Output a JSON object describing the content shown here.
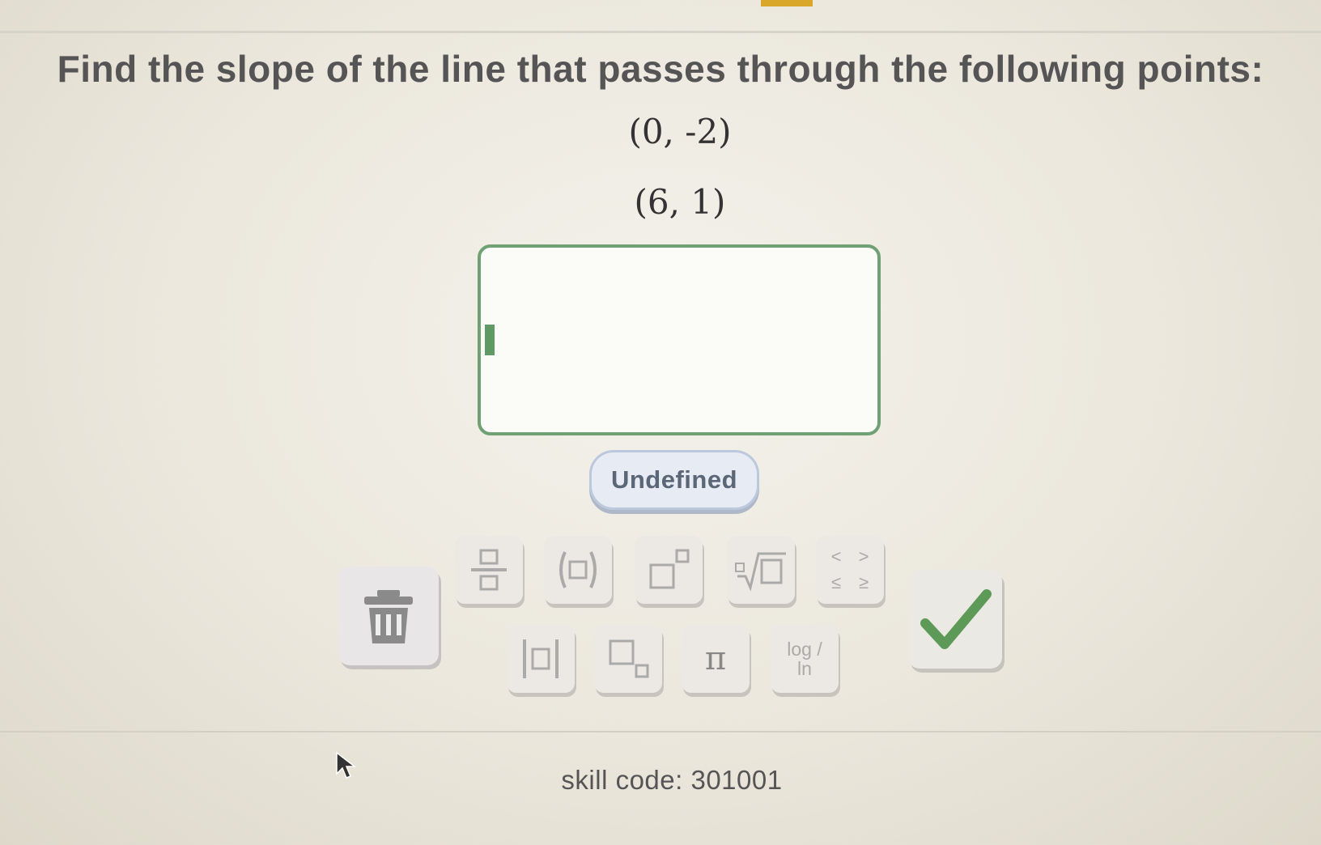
{
  "question": {
    "prompt": "Find the slope of the line that passes through the following points:",
    "points": [
      "(0, -2)",
      "(6, 1)"
    ]
  },
  "answer": {
    "value": ""
  },
  "undefined_button": {
    "label": "Undefined"
  },
  "toolbar": {
    "row1": [
      "fraction-icon",
      "parentheses-icon",
      "exponent-icon",
      "nth-root-icon",
      "inequality-icon"
    ],
    "row2": [
      "absolute-value-icon",
      "subscript-icon",
      "pi-icon",
      "log-ln-icon"
    ],
    "pi_label": "π",
    "log_label_top": "log /",
    "log_label_bottom": "ln",
    "inequality_symbols": [
      "<",
      ">",
      "≤",
      "≥"
    ]
  },
  "footer": {
    "skill_code": "skill code: 301001"
  },
  "colors": {
    "accent_green": "#6fa174",
    "check_green": "#5d9a58",
    "undefined_bg": "#e6ebf4"
  }
}
